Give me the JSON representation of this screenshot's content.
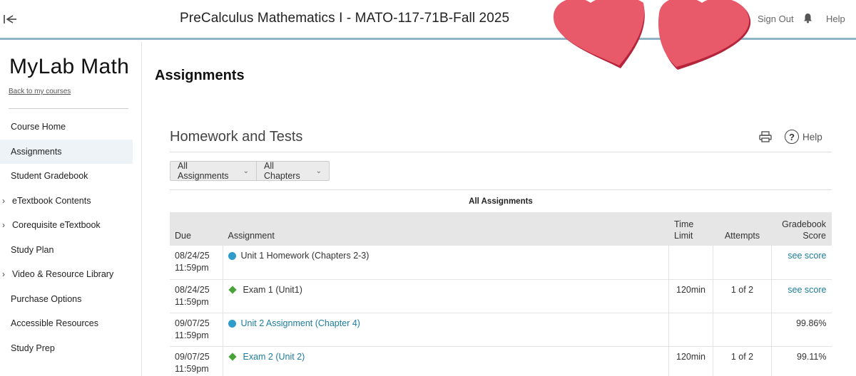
{
  "header": {
    "course_title": "PreCalculus Mathematics I - MATO-117-71B-Fall 2025",
    "sign_out": "Sign Out",
    "help": "Help"
  },
  "sidebar": {
    "brand": "MyLab Math",
    "back_link": "Back to my courses",
    "items": [
      {
        "label": "Course Home"
      },
      {
        "label": "Assignments",
        "active": true
      },
      {
        "label": "Student Gradebook"
      },
      {
        "label": "eTextbook Contents",
        "expandable": true
      },
      {
        "label": "Corequisite eTextbook",
        "expandable": true
      },
      {
        "label": "Study Plan"
      },
      {
        "label": "Video & Resource Library",
        "expandable": true
      },
      {
        "label": "Purchase Options"
      },
      {
        "label": "Accessible Resources"
      },
      {
        "label": "Study Prep"
      }
    ]
  },
  "main": {
    "page_title": "Assignments",
    "section_title": "Homework and Tests",
    "help_label": "Help",
    "filters": {
      "assignments": "All Assignments",
      "chapters": "All Chapters"
    },
    "table_caption": "All Assignments",
    "columns": {
      "due": "Due",
      "assignment": "Assignment",
      "time_limit_1": "Time",
      "time_limit_2": "Limit",
      "attempts": "Attempts",
      "score_1": "Gradebook",
      "score_2": "Score"
    },
    "rows": [
      {
        "due_date": "08/24/25",
        "due_time": "11:59pm",
        "icon": "circle-homework-icon",
        "name": "Unit 1 Homework (Chapters 2-3)",
        "time_limit": "",
        "attempts": "",
        "score": "see score"
      },
      {
        "due_date": "08/24/25",
        "due_time": "11:59pm",
        "icon": "diamond-test-icon",
        "name": "Exam 1 (Unit1)",
        "time_limit": "120min",
        "attempts": "1 of 2",
        "score": "see score"
      },
      {
        "due_date": "09/07/25",
        "due_time": "11:59pm",
        "icon": "circle-homework-icon",
        "name": "Unit 2 Assignment (Chapter 4)",
        "time_limit": "",
        "attempts": "",
        "score": "99.86%"
      },
      {
        "due_date": "09/07/25",
        "due_time": "11:59pm",
        "icon": "diamond-test-icon",
        "name": "Exam 2 (Unit 2)",
        "time_limit": "120min",
        "attempts": "1 of 2",
        "score": "99.11%"
      }
    ]
  },
  "colors": {
    "accent_line": "#8fb3c7",
    "link": "#1d7d9e",
    "homework_dot": "#2f9ccb",
    "test_diamond": "#4aa33a",
    "heart": "#e85a6a"
  }
}
